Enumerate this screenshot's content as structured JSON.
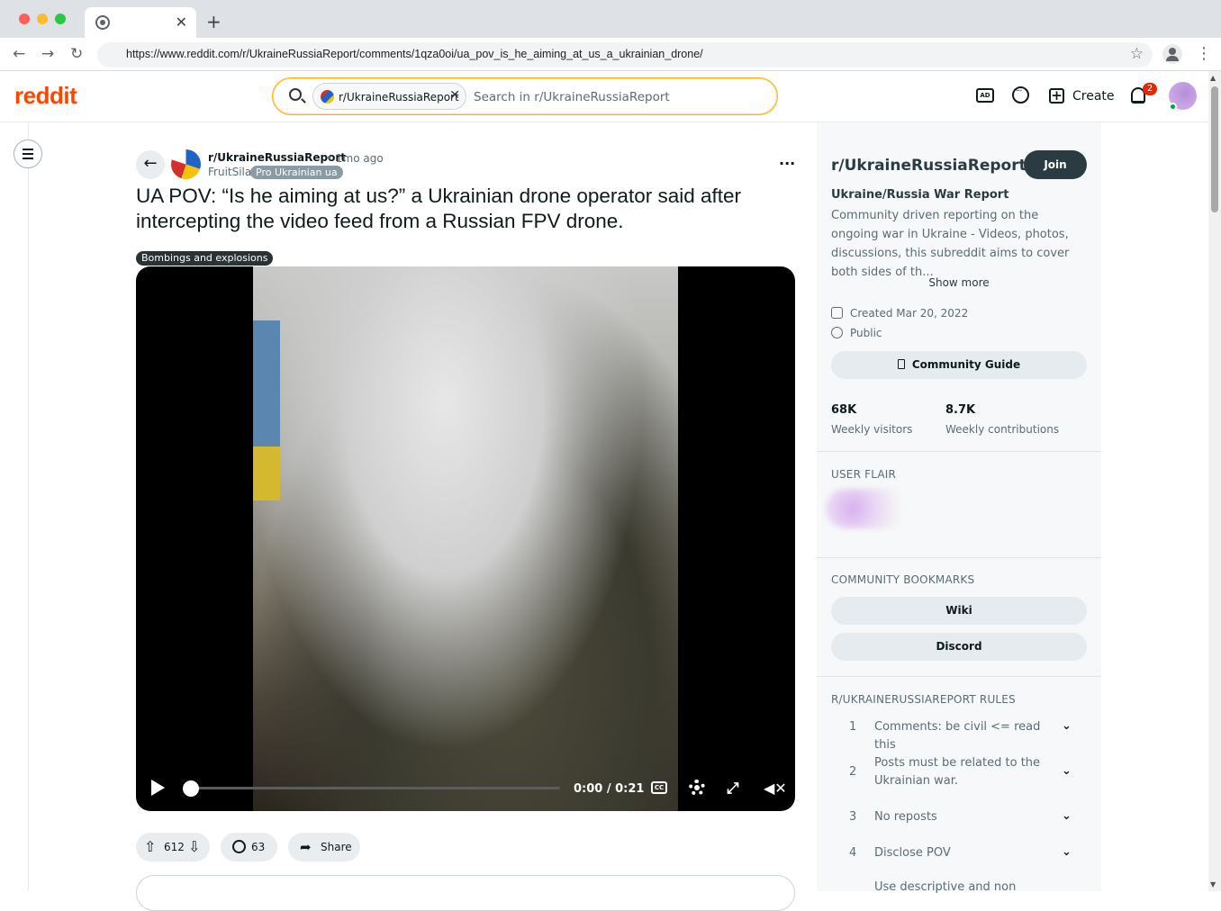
{
  "browser": {
    "url": "https://www.reddit.com/r/UkraineRussiaReport/comments/1qza0oi/ua_pov_is_he_aiming_at_us_a_ukrainian_drone/"
  },
  "header": {
    "logo": "reddit",
    "search_chip": "r/UkraineRussiaReport",
    "search_placeholder": "Search in r/UkraineRussiaReport",
    "create_label": "Create",
    "notification_count": "2"
  },
  "post": {
    "subreddit": "r/UkraineRussiaReport",
    "time": "• 1mo ago",
    "author": "FruitSila",
    "author_flair": "Pro Ukrainian ua",
    "title": "UA POV: “Is he aiming at us?” a Ukrainian drone operator said after intercepting the video feed from a Russian FPV drone.",
    "post_flair": "Bombings and explosions",
    "video_time": "0:00 / 0:21",
    "cc_label": "CC",
    "votes": "612",
    "comments": "63",
    "share_label": "Share"
  },
  "sidebar": {
    "title": "r/UkraineRussiaReport",
    "join_label": "Join",
    "subtitle": "Ukraine/Russia War Report",
    "description": "Community driven reporting on the ongoing war in Ukraine - Videos, photos, discussions, this subreddit aims to cover both sides of th...",
    "show_more": "Show more",
    "created": "Created Mar 20, 2022",
    "visibility": "Public",
    "guide_label": "Community Guide",
    "stats": [
      {
        "value": "68K",
        "label": "Weekly visitors"
      },
      {
        "value": "8.7K",
        "label": "Weekly contributions"
      }
    ],
    "user_flair_heading": "USER FLAIR",
    "bookmarks_heading": "COMMUNITY BOOKMARKS",
    "bookmarks": [
      "Wiki",
      "Discord"
    ],
    "rules_heading": "R/UKRAINERUSSIAREPORT RULES",
    "rules": [
      {
        "num": "1",
        "text": "Comments: be civil <= read this"
      },
      {
        "num": "2",
        "text": "Posts must be related to the Ukrainian war."
      },
      {
        "num": "3",
        "text": "No reposts"
      },
      {
        "num": "4",
        "text": "Disclose POV"
      },
      {
        "num": "",
        "text": "Use descriptive and non"
      }
    ]
  }
}
